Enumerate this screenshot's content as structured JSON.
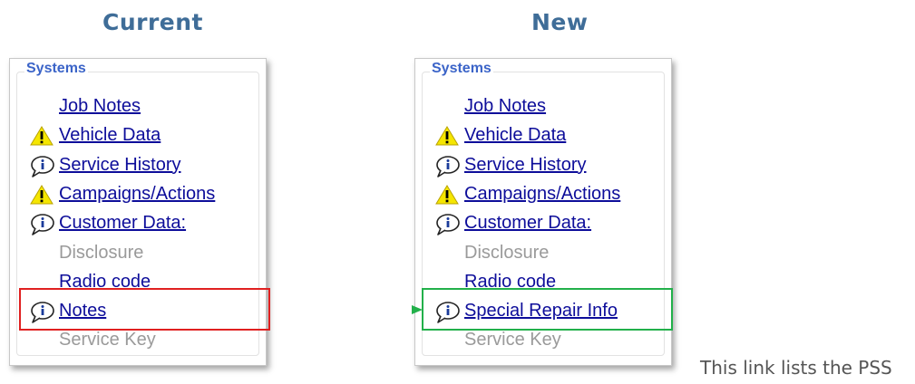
{
  "left": {
    "heading": "Current",
    "legend": "Systems",
    "items": [
      {
        "label": "Job Notes",
        "style": "link",
        "icon": "none"
      },
      {
        "label": "Vehicle Data",
        "style": "link",
        "icon": "warning-icon"
      },
      {
        "label": "Service History",
        "style": "link",
        "icon": "info-icon"
      },
      {
        "label": "Campaigns/Actions",
        "style": "link",
        "icon": "warning-icon"
      },
      {
        "label": "Customer Data:",
        "style": "link",
        "icon": "info-icon"
      },
      {
        "label": "Disclosure",
        "style": "muted",
        "icon": "none"
      },
      {
        "label": "Radio code",
        "style": "link",
        "icon": "none"
      },
      {
        "label": "Notes",
        "style": "link",
        "icon": "info-icon"
      },
      {
        "label": "Service Key",
        "style": "muted",
        "icon": "none"
      }
    ]
  },
  "right": {
    "heading": "New",
    "legend": "Systems",
    "items": [
      {
        "label": "Job Notes",
        "style": "link",
        "icon": "none"
      },
      {
        "label": "Vehicle Data",
        "style": "link",
        "icon": "warning-icon"
      },
      {
        "label": "Service History",
        "style": "link",
        "icon": "info-icon"
      },
      {
        "label": "Campaigns/Actions",
        "style": "link",
        "icon": "warning-icon"
      },
      {
        "label": "Customer Data:",
        "style": "link",
        "icon": "info-icon"
      },
      {
        "label": "Disclosure",
        "style": "muted",
        "icon": "none"
      },
      {
        "label": "Radio code",
        "style": "link",
        "icon": "none"
      },
      {
        "label": "Special Repair Info",
        "style": "link",
        "icon": "info-icon"
      },
      {
        "label": "Service Key",
        "style": "muted",
        "icon": "none"
      }
    ]
  },
  "caption": "This link lists the PSS",
  "colors": {
    "heading": "#3f6d98",
    "link": "#0d0d9a",
    "muted": "#9a9a9a",
    "highlight_old": "#e02020",
    "highlight_new": "#22b04a"
  }
}
